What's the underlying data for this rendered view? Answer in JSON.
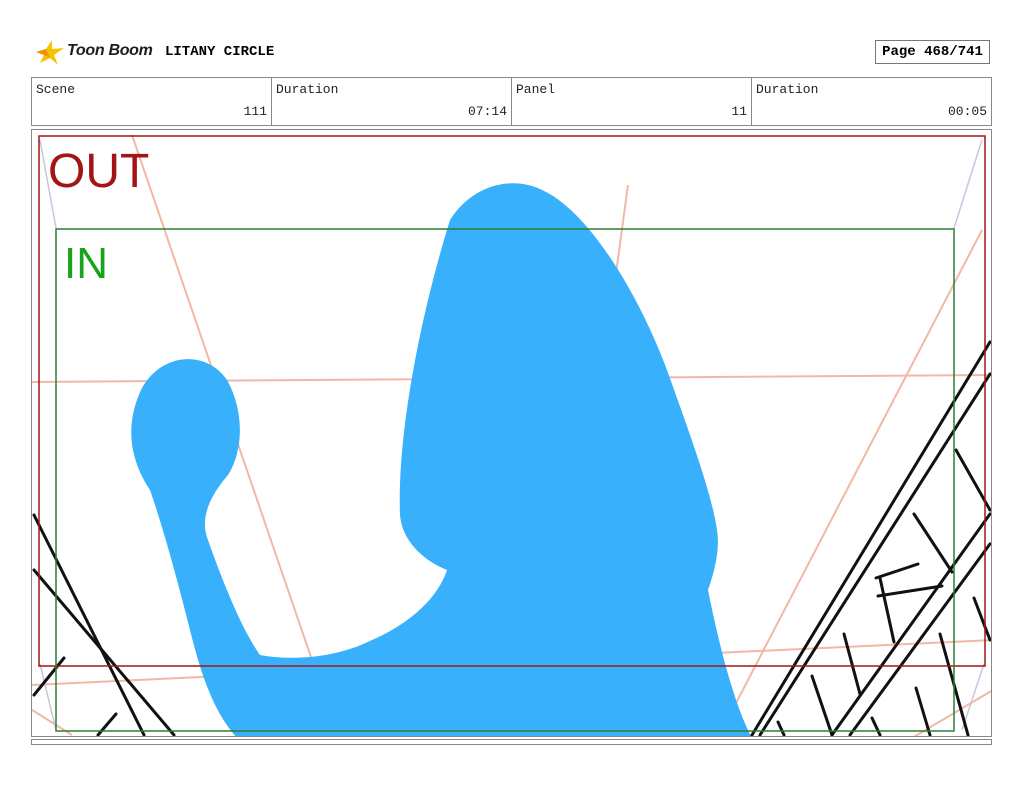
{
  "header": {
    "logo_text": "Toon Boom",
    "project_title": "LITANY CIRCLE",
    "page_label": "Page 468/741"
  },
  "info": {
    "scene_label": "Scene",
    "scene_value": "111",
    "scene_duration_label": "Duration",
    "scene_duration_value": "07:14",
    "panel_label": "Panel",
    "panel_value": "11",
    "panel_duration_label": "Duration",
    "panel_duration_value": "00:05"
  },
  "panel": {
    "out_label": "OUT",
    "in_label": "IN",
    "colors": {
      "out_frame": "#a31515",
      "in_frame": "#2e7d32",
      "silhouette": "#38b0fb",
      "guide_lines": "#f2b8a6"
    }
  }
}
